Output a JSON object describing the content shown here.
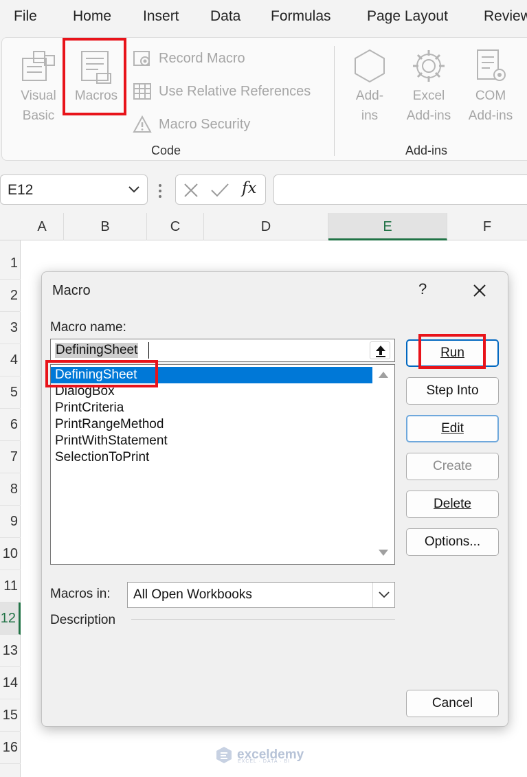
{
  "menu": {
    "items": [
      "File",
      "Home",
      "Insert",
      "Data",
      "Formulas",
      "Page Layout",
      "Review"
    ]
  },
  "ribbon": {
    "visual_basic": [
      "Visual",
      "Basic"
    ],
    "macros": "Macros",
    "record_macro": "Record Macro",
    "use_relative_references": "Use Relative References",
    "macro_security": "Macro Security",
    "code_group": "Code",
    "addins": [
      "Add-",
      "ins"
    ],
    "excel_addins": [
      "Excel",
      "Add-ins"
    ],
    "com_addins": [
      "COM",
      "Add-ins"
    ],
    "addins_group": "Add-ins"
  },
  "formula_bar": {
    "name_box": "E12",
    "fx": "fx",
    "formula": ""
  },
  "grid": {
    "columns": [
      "A",
      "B",
      "C",
      "D",
      "E",
      "F"
    ],
    "selected_column": "E",
    "rows": [
      "1",
      "2",
      "3",
      "4",
      "5",
      "6",
      "7",
      "8",
      "9",
      "10",
      "11",
      "12",
      "13",
      "14",
      "15",
      "16"
    ],
    "selected_row": "12"
  },
  "dialog": {
    "title": "Macro",
    "help": "?",
    "macro_name_label": "Macro name:",
    "macro_name_value": "DefiningSheet",
    "macros": [
      "DefiningSheet",
      "DialogBox",
      "PrintCriteria",
      "PrintRangeMethod",
      "PrintWithStatement",
      "SelectionToPrint"
    ],
    "selected_macro": "DefiningSheet",
    "buttons": {
      "run": "Run",
      "step_into": "Step Into",
      "edit": "Edit",
      "create": "Create",
      "delete": "Delete",
      "options": "Options...",
      "cancel": "Cancel"
    },
    "macros_in_label": "Macros in:",
    "macros_in_value": "All Open Workbooks",
    "description_label": "Description"
  },
  "watermark": {
    "name": "exceldemy",
    "tagline": "EXCEL · DATA · BI"
  },
  "colors": {
    "highlight_red": "#e8131a",
    "selection_blue": "#0078d7",
    "excel_green": "#217346"
  }
}
